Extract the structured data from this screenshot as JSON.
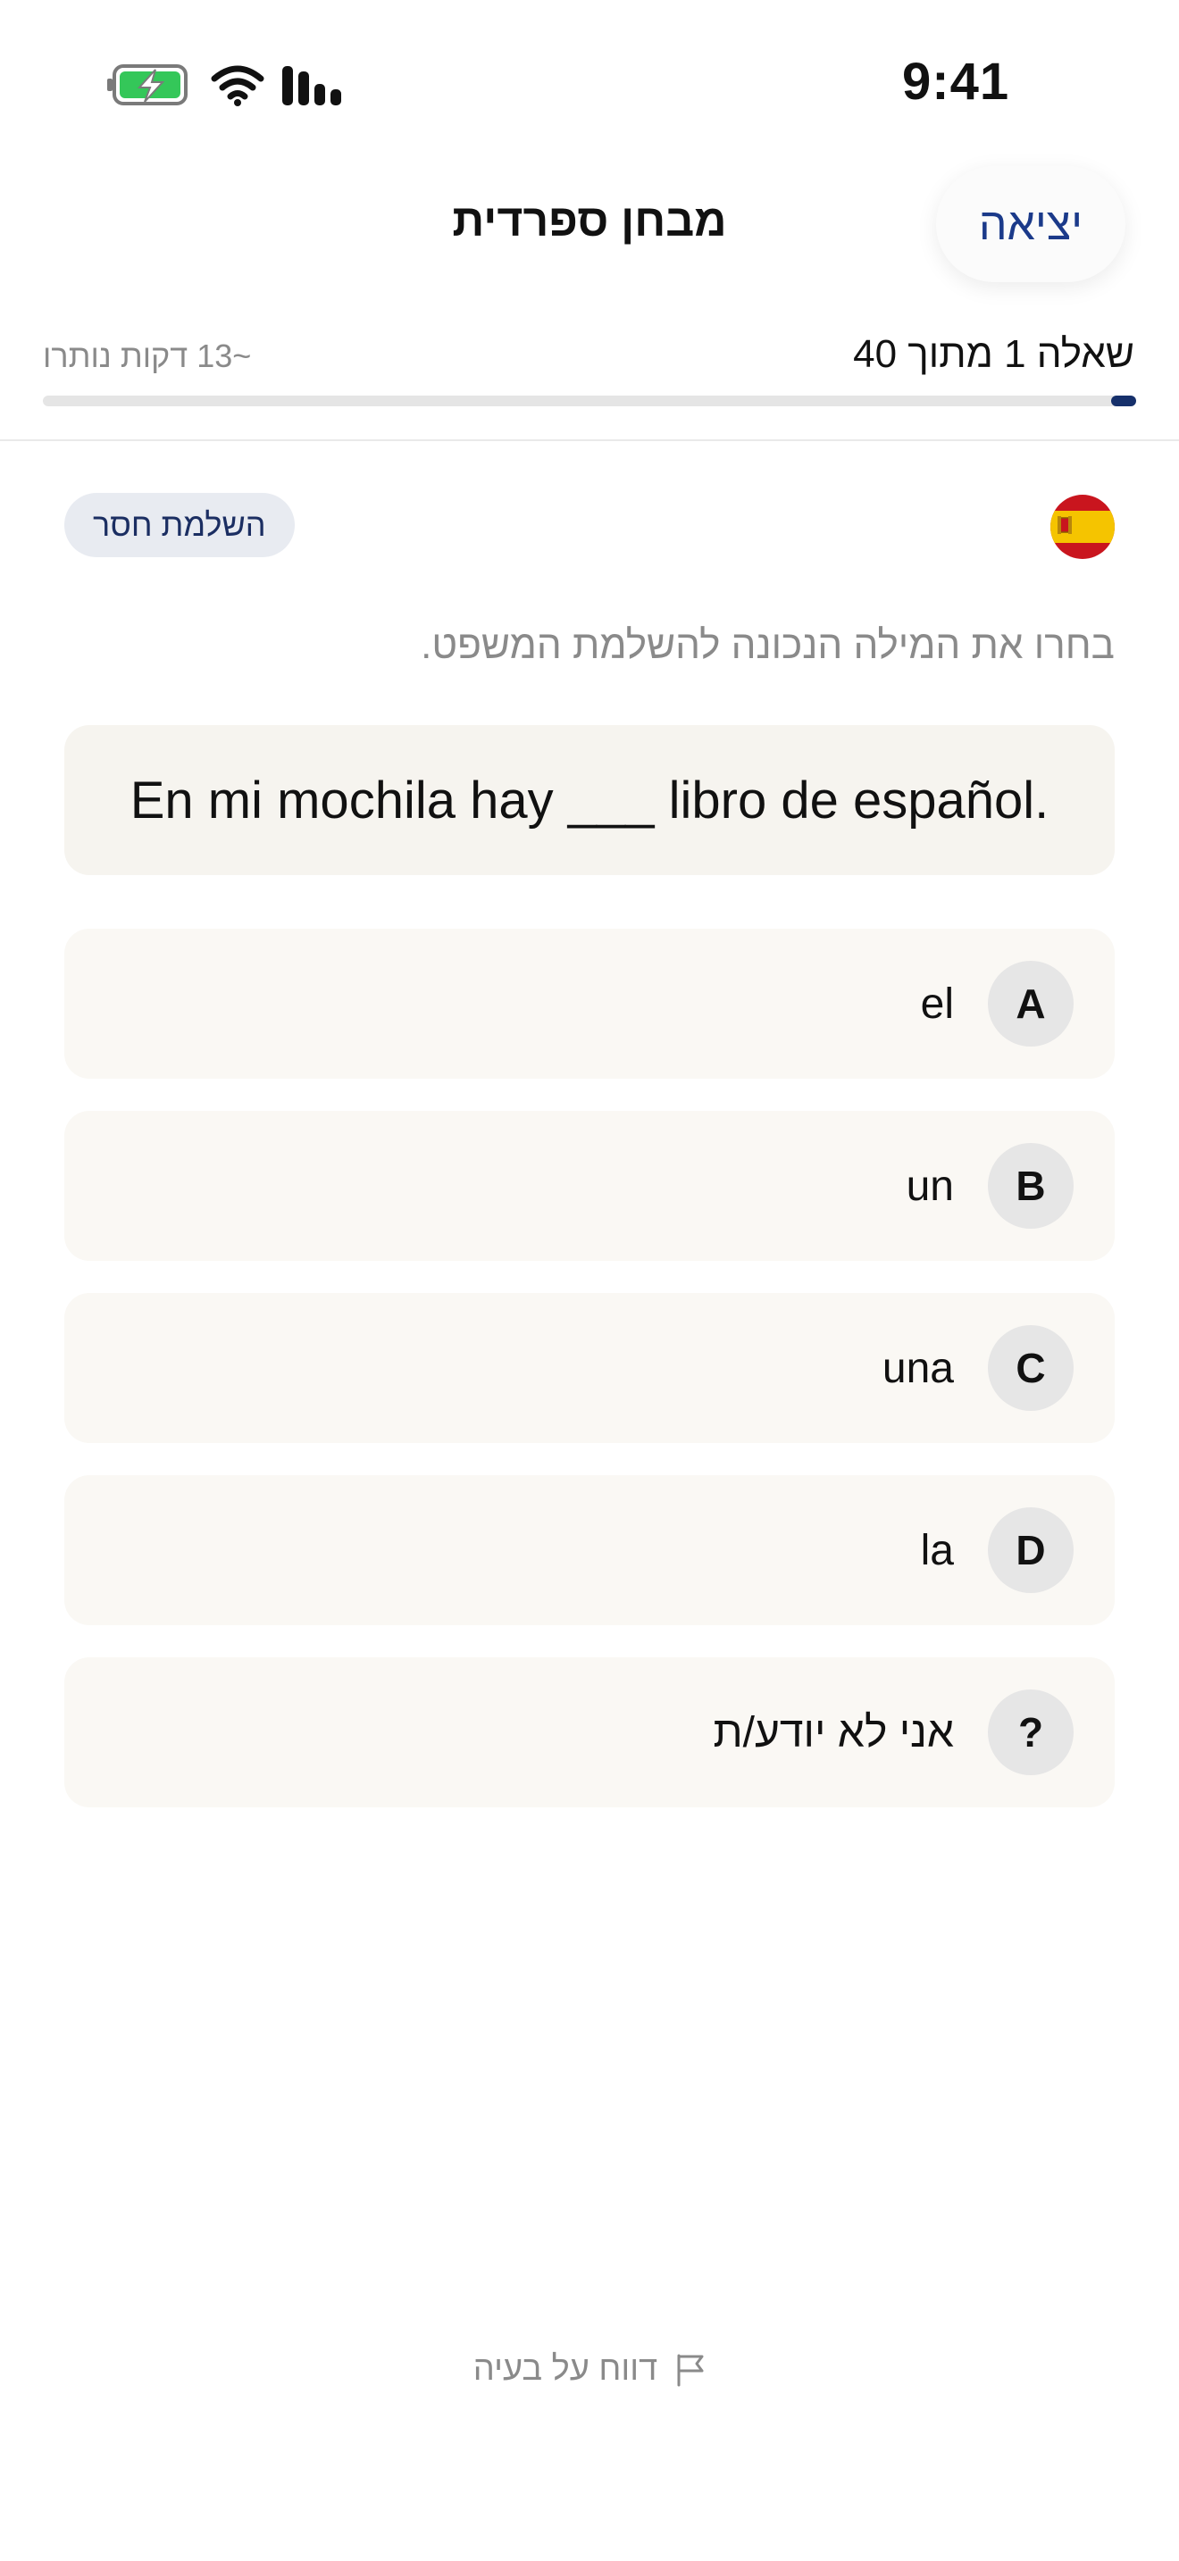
{
  "status_bar": {
    "time": "9:41"
  },
  "header": {
    "title": "מבחן ספרדית",
    "exit_label": "יציאה"
  },
  "progress": {
    "counter": "שאלה 1 מתוך 40",
    "time_left": "~13 דקות נותרו",
    "current": 1,
    "total": 40
  },
  "question": {
    "type_badge": "השלמת חסר",
    "language_flag": "spain-flag-icon",
    "instruction": "בחרו את המילה הנכונה להשלמת המשפט.",
    "sentence": "En mi mochila hay ___ libro de español."
  },
  "options": [
    {
      "letter": "A",
      "text": "el"
    },
    {
      "letter": "B",
      "text": "un"
    },
    {
      "letter": "C",
      "text": "una"
    },
    {
      "letter": "D",
      "text": "la"
    },
    {
      "letter": "?",
      "text": "אני לא יודע/ת"
    }
  ],
  "footer": {
    "report_label": "דווח על בעיה"
  },
  "colors": {
    "accent": "#16306b",
    "link": "#1b3a8a",
    "card": "#f6f4ef",
    "option_bg": "#faf8f4"
  }
}
